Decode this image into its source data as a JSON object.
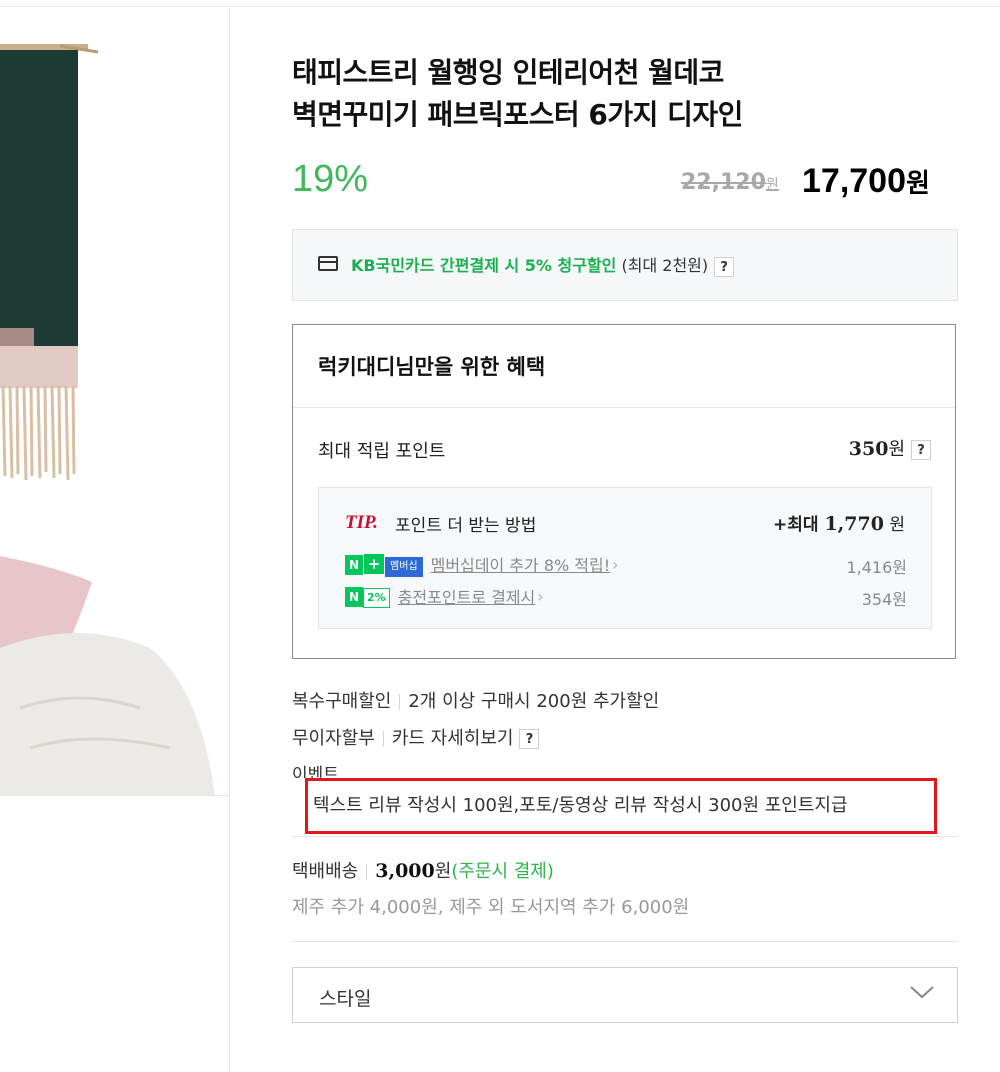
{
  "product": {
    "title_line1": "태피스트리 월행잉 인테리어천 월데코",
    "title_line2": "벽면꾸미기 패브릭포스터 6가지 디자인",
    "discount": "19%",
    "original_price": "22,120",
    "original_unit": "원",
    "sale_price": "17,700",
    "sale_unit": "원"
  },
  "card_promo": {
    "highlight": "KB국민카드 간편결제 시 5% 청구할인",
    "note": " (최대 2천원)",
    "help": "?"
  },
  "benefit": {
    "heading": "럭키대디님만을 위한 혜택",
    "max_points_label": "최대 적립 포인트",
    "max_points_value": "350",
    "max_points_unit": "원",
    "help": "?",
    "tip": {
      "mark": "TIP.",
      "label": "포인트 더 받는 방법",
      "total_prefix": "+최대 ",
      "total_value": "1,770",
      "total_unit": " 원",
      "rows": [
        {
          "badge_n": "N",
          "badge_plus": "+",
          "badge_text": "멤버십",
          "text": "멤버십데이 추가 8% 적립!",
          "value": "1,416원"
        },
        {
          "badge_n": "N",
          "badge_text": "2%",
          "text": "충전포인트로 결제시",
          "value": "354원"
        }
      ]
    }
  },
  "info": {
    "multi_label": "복수구매할인",
    "multi_value": "2개 이상 구매시 200원 추가할인",
    "nointerest_label": "무이자할부",
    "nointerest_value": "카드 자세히보기",
    "help": "?",
    "event_label": "이벤트",
    "event_value": "텍스트 리뷰 작성시 100원,포토/동영상 리뷰 작성시 300원 포인트지급"
  },
  "shipping": {
    "label": "택배배송",
    "price": "3,000",
    "unit": "원",
    "note": "(주문시 결제)",
    "extra": "제주 추가 4,000원, 제주 외 도서지역 추가 6,000원"
  },
  "option": {
    "label": "스타일",
    "icon": "chevron-down-icon"
  },
  "colors": {
    "discount_green": "#41b85c",
    "card_green": "#19b14f",
    "tip_red": "#c8102e",
    "highlight_box": "#e3161a",
    "naver_green": "#03c75a",
    "membership_blue": "#2d6ad8"
  }
}
